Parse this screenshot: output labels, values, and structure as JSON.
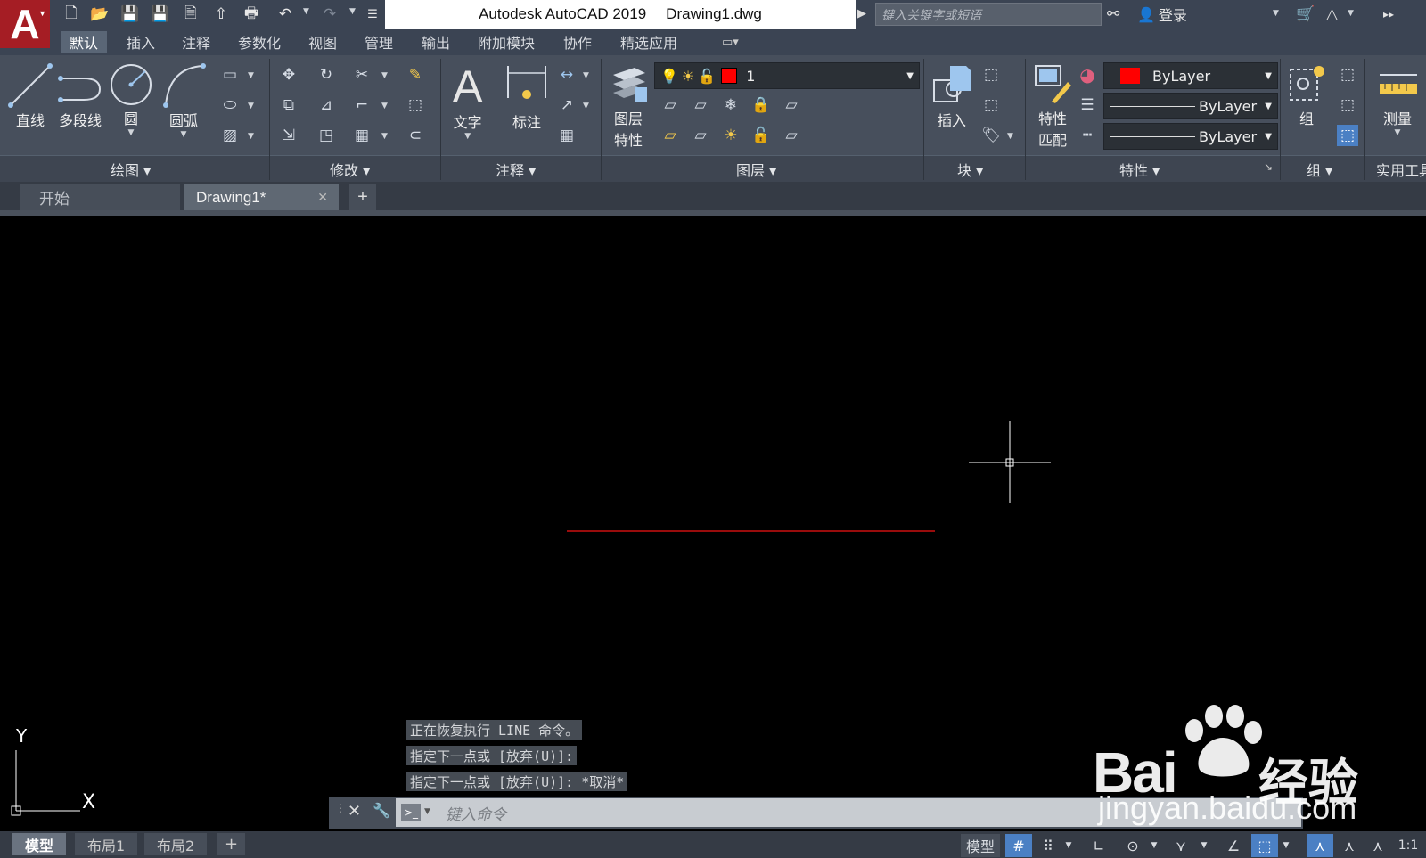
{
  "app": {
    "title": "Autodesk AutoCAD 2019",
    "file": "Drawing1.dwg",
    "logo_letter": "A"
  },
  "search": {
    "placeholder": "键入关键字或短语"
  },
  "account": {
    "login": "登录"
  },
  "ribbon_tabs": [
    "默认",
    "插入",
    "注释",
    "参数化",
    "视图",
    "管理",
    "输出",
    "附加模块",
    "协作",
    "精选应用"
  ],
  "draw": {
    "line": "直线",
    "polyline": "多段线",
    "circle": "圆",
    "arc": "圆弧",
    "title": "绘图"
  },
  "modify": {
    "title": "修改"
  },
  "annotation": {
    "text": "文字",
    "dimension": "标注",
    "title": "注释"
  },
  "layers": {
    "layer_props_1": "图层",
    "layer_props_2": "特性",
    "current_layer": "1",
    "title": "图层"
  },
  "block": {
    "insert": "插入",
    "title": "块"
  },
  "properties": {
    "match_1": "特性",
    "match_2": "匹配",
    "color": "ByLayer",
    "lineweight": "ByLayer",
    "linetype": "ByLayer",
    "title": "特性"
  },
  "groups": {
    "group": "组",
    "title": "组"
  },
  "utilities": {
    "measure": "测量",
    "title": "实用工具"
  },
  "doc_tabs": {
    "start": "开始",
    "drawing": "Drawing1*"
  },
  "command": {
    "history": [
      "正在恢复执行 LINE 命令。",
      "指定下一点或 [放弃(U)]:",
      "指定下一点或 [放弃(U)]: *取消*"
    ],
    "placeholder": "键入命令"
  },
  "ucs": {
    "x": "X",
    "y": "Y"
  },
  "layouts": {
    "model": "模型",
    "layout1": "布局1",
    "layout2": "布局2"
  },
  "status": {
    "model": "模型",
    "scale": "1:1"
  },
  "watermark": {
    "brand": "Bai",
    "brand_cn": "经验",
    "url": "jingyan.baidu.com"
  },
  "colors": {
    "line": "#cc1111",
    "layer_swatch": "#ff0000",
    "title_bar": "#3b4453",
    "ribbon": "#474f5c",
    "status_on": "#4b80c4"
  }
}
